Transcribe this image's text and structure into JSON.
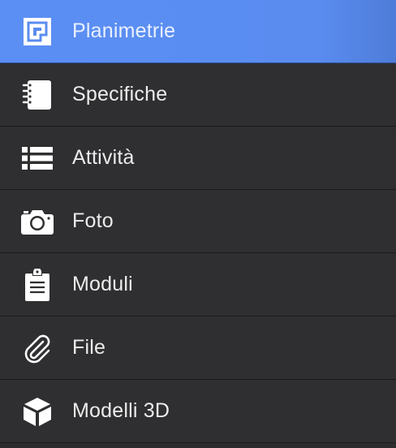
{
  "menu": {
    "items": [
      {
        "label": "Planimetrie",
        "icon": "floorplan-icon",
        "active": true
      },
      {
        "label": "Specifiche",
        "icon": "notebook-icon",
        "active": false
      },
      {
        "label": "Attività",
        "icon": "list-icon",
        "active": false
      },
      {
        "label": "Foto",
        "icon": "camera-icon",
        "active": false
      },
      {
        "label": "Moduli",
        "icon": "clipboard-icon",
        "active": false
      },
      {
        "label": "File",
        "icon": "paperclip-icon",
        "active": false
      },
      {
        "label": "Modelli 3D",
        "icon": "cube-icon",
        "active": false
      }
    ]
  },
  "colors": {
    "active_background": "#5a8cf0",
    "background": "#2f2f31",
    "separator": "#1a1a1b",
    "text": "#ececec"
  }
}
